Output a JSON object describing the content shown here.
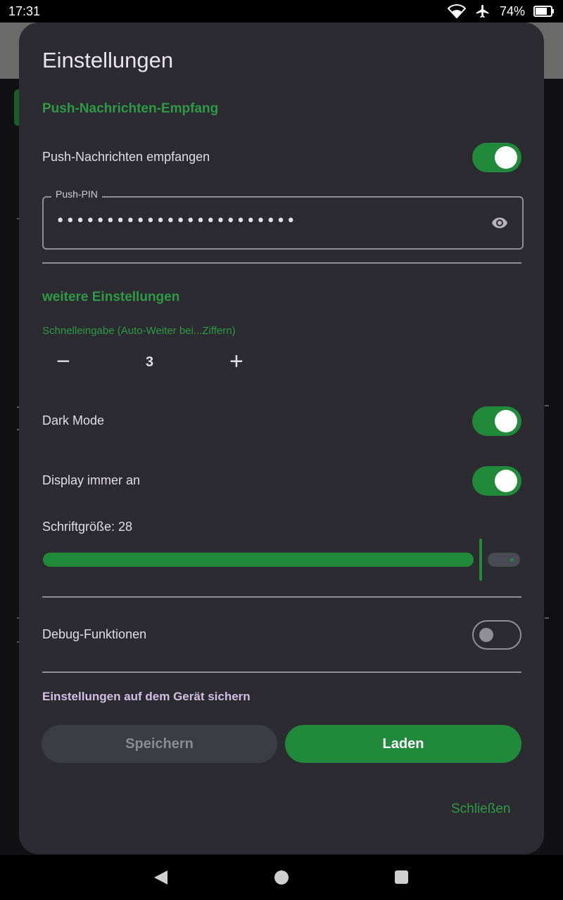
{
  "status_bar": {
    "time": "17:31",
    "battery": "74%",
    "icons": [
      "wifi-icon",
      "airplane-icon",
      "battery-icon"
    ]
  },
  "dialog": {
    "title": "Einstellungen",
    "push_section": {
      "heading": "Push-Nachrichten-Empfang",
      "receive_label": "Push-Nachrichten empfangen",
      "receive_on": true,
      "pin_label": "Push-PIN",
      "pin_value": "••••••••••••••••••••••••"
    },
    "more_section": {
      "heading": "weitere Einstellungen",
      "quick_input_label": "Schnelleingabe (Auto-Weiter bei...Ziffern)",
      "quick_input_value": "3",
      "dark_mode_label": "Dark Mode",
      "dark_mode_on": true,
      "display_on_label": "Display immer an",
      "display_on_on": true,
      "font_size_label": "Schriftgröße: 28",
      "font_size_fraction": 0.93
    },
    "debug": {
      "label": "Debug-Funktionen",
      "on": false
    },
    "backup": {
      "heading": "Einstellungen auf dem Gerät sichern",
      "save_label": "Speichern",
      "load_label": "Laden"
    },
    "close_label": "Schließen"
  },
  "colors": {
    "accent": "#218a3a",
    "accent_text": "#2e9a45",
    "dialog_bg": "#2b2b31",
    "backup_heading": "#d3bfe6"
  }
}
